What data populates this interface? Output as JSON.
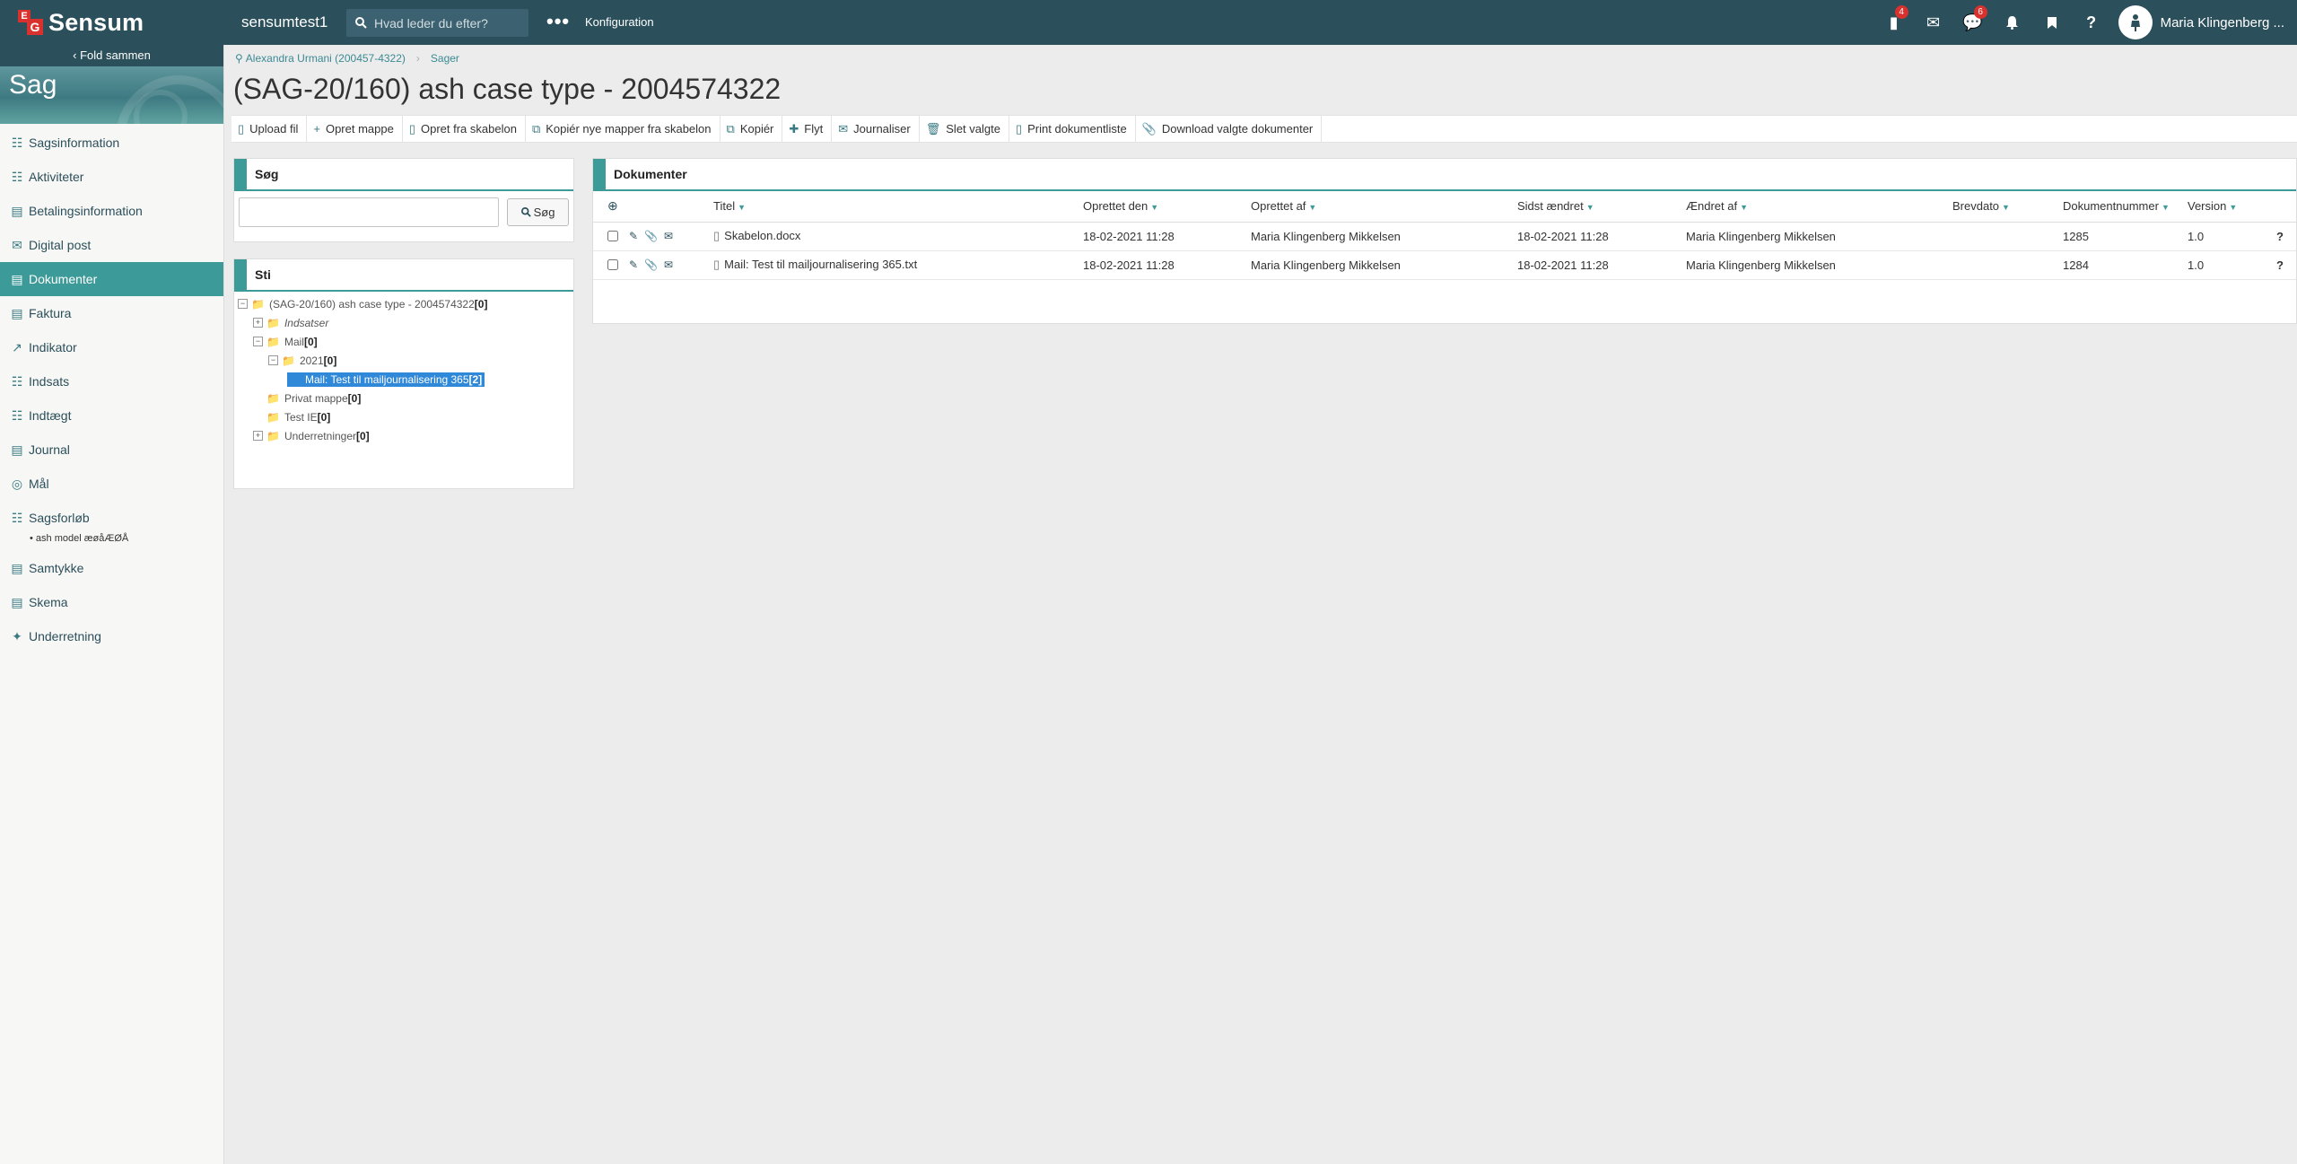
{
  "topbar": {
    "logo_mark_top": "E",
    "logo_mark_bottom": "G",
    "logo_text": "Sensum",
    "tenant": "sensumtest1",
    "search_placeholder": "Hvad leder du efter?",
    "more_label": "•••",
    "config_label": "Konfiguration",
    "badges": {
      "tasks": "4",
      "messages": "6"
    },
    "user_name": "Maria Klingenberg ..."
  },
  "sidebar": {
    "fold_label": "Fold sammen",
    "title": "Sag",
    "items": [
      {
        "label": "Sagsinformation",
        "icon": "case-info-icon"
      },
      {
        "label": "Aktiviteter",
        "icon": "activities-icon"
      },
      {
        "label": "Betalingsinformation",
        "icon": "payment-icon"
      },
      {
        "label": "Digital post",
        "icon": "mail-icon"
      },
      {
        "label": "Dokumenter",
        "icon": "documents-icon",
        "active": true
      },
      {
        "label": "Faktura",
        "icon": "invoice-icon"
      },
      {
        "label": "Indikator",
        "icon": "chart-icon"
      },
      {
        "label": "Indsats",
        "icon": "effort-icon"
      },
      {
        "label": "Indtægt",
        "icon": "income-icon"
      },
      {
        "label": "Journal",
        "icon": "journal-icon"
      },
      {
        "label": "Mål",
        "icon": "target-icon"
      },
      {
        "label": "Sagsforløb",
        "icon": "case-flow-icon"
      },
      {
        "label": "Samtykke",
        "icon": "consent-icon"
      },
      {
        "label": "Skema",
        "icon": "form-icon"
      },
      {
        "label": "Underretning",
        "icon": "notification-icon"
      }
    ],
    "sub_item": "• ash model æøåÆØÅ"
  },
  "breadcrumb": {
    "person": "Alexandra Urmani (200457-4322)",
    "section": "Sager"
  },
  "page_title": "(SAG-20/160) ash case type - 2004574322",
  "toolbar": [
    {
      "label": "Upload fil",
      "icon": "file-icon"
    },
    {
      "label": "Opret mappe",
      "icon": "plus-icon"
    },
    {
      "label": "Opret fra skabelon",
      "icon": "file-icon"
    },
    {
      "label": "Kopiér nye mapper fra skabelon",
      "icon": "copy-icon"
    },
    {
      "label": "Kopiér",
      "icon": "copy-icon"
    },
    {
      "label": "Flyt",
      "icon": "move-icon"
    },
    {
      "label": "Journaliser",
      "icon": "envelope-icon"
    },
    {
      "label": "Slet valgte",
      "icon": "trash-icon"
    },
    {
      "label": "Print dokumentliste",
      "icon": "file-icon"
    },
    {
      "label": "Download valgte dokumenter",
      "icon": "paperclip-icon"
    }
  ],
  "search_panel": {
    "title": "Søg",
    "input_value": "",
    "button_label": "Søg"
  },
  "path_panel": {
    "title": "Sti",
    "root": {
      "label": "(SAG-20/160) ash case type - 2004574322",
      "count": "[0]"
    },
    "nodes": [
      {
        "label": "Indsatser",
        "count": ""
      },
      {
        "label": "Mail",
        "count": "[0]"
      },
      {
        "label": "2021",
        "count": "[0]"
      },
      {
        "label": "Mail: Test til mailjournalisering 365",
        "count": "[2]"
      },
      {
        "label": "Privat mappe",
        "count": "[0]"
      },
      {
        "label": "Test IE",
        "count": "[0]"
      },
      {
        "label": "Underretninger",
        "count": "[0]"
      }
    ]
  },
  "documents": {
    "title": "Dokumenter",
    "columns": [
      "Titel",
      "Oprettet den",
      "Oprettet af",
      "Sidst ændret",
      "Ændret af",
      "Brevdato",
      "Dokumentnummer",
      "Version"
    ],
    "rows": [
      {
        "title": "Skabelon.docx",
        "created": "18-02-2021 11:28",
        "created_by": "Maria Klingenberg Mikkelsen",
        "modified": "18-02-2021 11:28",
        "modified_by": "Maria Klingenberg Mikkelsen",
        "letter_date": "",
        "doc_number": "1285",
        "version": "1.0",
        "help": "?"
      },
      {
        "title": "Mail: Test til mailjournalisering 365.txt",
        "created": "18-02-2021 11:28",
        "created_by": "Maria Klingenberg Mikkelsen",
        "modified": "18-02-2021 11:28",
        "modified_by": "Maria Klingenberg Mikkelsen",
        "letter_date": "",
        "doc_number": "1284",
        "version": "1.0",
        "help": "?"
      }
    ]
  }
}
